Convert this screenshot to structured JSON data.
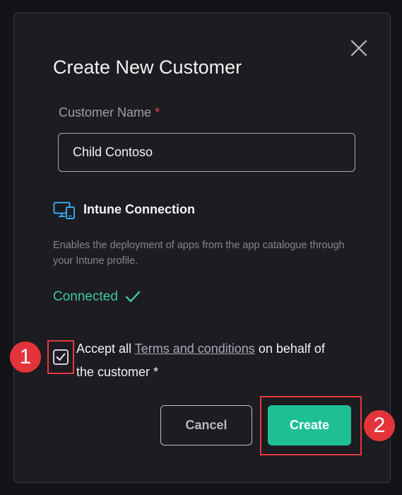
{
  "dialog": {
    "title": "Create New Customer",
    "close_icon": "close-icon"
  },
  "customer_name": {
    "label": "Customer Name",
    "required_mark": "*",
    "value": "Child Contoso"
  },
  "intune": {
    "icon": "devices-icon",
    "title": "Intune Connection",
    "description": "Enables the deployment of apps from the app catalogue through your Intune profile.",
    "status": "Connected",
    "status_icon": "checkmark-icon"
  },
  "terms": {
    "checked": true,
    "prefix": "Accept all ",
    "link": "Terms and conditions",
    "suffix": " on behalf of the customer *"
  },
  "buttons": {
    "cancel": "Cancel",
    "create": "Create"
  },
  "annotations": {
    "badge_1": "1",
    "badge_2": "2",
    "highlight_color": "#e5393f"
  },
  "colors": {
    "accent": "#1fbf95",
    "connected": "#3fc79a",
    "required": "#e0454f"
  }
}
